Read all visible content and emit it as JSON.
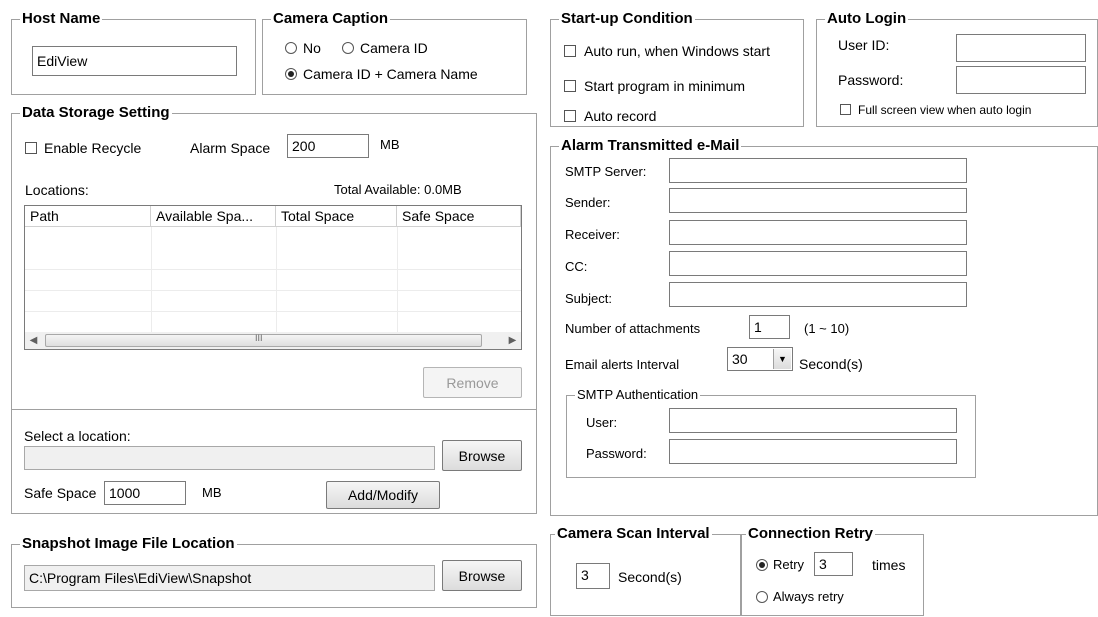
{
  "host_name": {
    "title": "Host Name",
    "value": "EdiView"
  },
  "camera_caption": {
    "title": "Camera Caption",
    "options": [
      {
        "label": "No",
        "selected": false
      },
      {
        "label": "Camera ID",
        "selected": false
      },
      {
        "label": "Camera ID + Camera Name",
        "selected": true
      }
    ]
  },
  "startup": {
    "title": "Start-up Condition",
    "options": [
      {
        "label": "Auto run, when Windows start",
        "checked": false
      },
      {
        "label": "Start program in minimum",
        "checked": false
      },
      {
        "label": "Auto record",
        "checked": false
      }
    ]
  },
  "auto_login": {
    "title": "Auto Login",
    "user_label": "User ID:",
    "user_value": "",
    "password_label": "Password:",
    "password_value": "",
    "fullscreen_label": "Full screen view when auto login",
    "fullscreen_checked": false
  },
  "data_storage": {
    "title": "Data Storage Setting",
    "enable_recycle_label": "Enable Recycle",
    "enable_recycle_checked": false,
    "alarm_space_label": "Alarm Space",
    "alarm_space_value": "200",
    "alarm_space_unit": "MB",
    "locations_label": "Locations:",
    "total_available": "Total Available: 0.0MB",
    "columns": [
      "Path",
      "Available Spa...",
      "Total Space",
      "Safe Space"
    ],
    "rows": [],
    "scroll_marker": "III",
    "remove_label": "Remove",
    "select_location_label": "Select a location:",
    "location_value": "",
    "browse_label": "Browse",
    "safe_space_label": "Safe Space",
    "safe_space_value": "1000",
    "safe_space_unit": "MB",
    "add_modify_label": "Add/Modify"
  },
  "alarm_email": {
    "title": "Alarm Transmitted e-Mail",
    "fields": [
      {
        "label": "SMTP Server:",
        "value": ""
      },
      {
        "label": "Sender:",
        "value": ""
      },
      {
        "label": "Receiver:",
        "value": ""
      },
      {
        "label": "CC:",
        "value": ""
      },
      {
        "label": "Subject:",
        "value": ""
      }
    ],
    "attachments_label": "Number of attachments",
    "attachments_value": "1",
    "attachments_range": "(1 ~ 10)",
    "interval_label": "Email alerts Interval",
    "interval_value": "30",
    "interval_unit": "Second(s)",
    "auth": {
      "title": "SMTP Authentication",
      "user_label": "User:",
      "user_value": "",
      "password_label": "Password:",
      "password_value": ""
    }
  },
  "snapshot": {
    "title": "Snapshot Image File Location",
    "path": "C:\\Program Files\\EdiView\\Snapshot",
    "browse_label": "Browse"
  },
  "camera_scan": {
    "title": "Camera Scan Interval",
    "value": "3",
    "unit": "Second(s)"
  },
  "connection_retry": {
    "title": "Connection Retry",
    "retry_label": "Retry",
    "retry_value": "3",
    "retry_unit": "times",
    "retry_selected": true,
    "always_label": "Always retry",
    "always_selected": false
  }
}
